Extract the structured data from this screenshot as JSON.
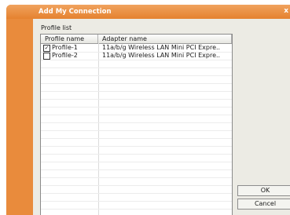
{
  "window": {
    "title": "Add My Connection",
    "close_glyph": "x"
  },
  "profile_list": {
    "label": "Profile list",
    "columns": [
      "Profile name",
      "Adapter name"
    ],
    "rows": [
      {
        "checked": true,
        "name": "Profile-1",
        "adapter": "11a/b/g Wireless LAN Mini PCI Expre.."
      },
      {
        "checked": false,
        "name": "Profile-2",
        "adapter": "11a/b/g Wireless LAN Mini PCI Expre.."
      }
    ],
    "empty_rows": 21
  },
  "buttons": {
    "ok": "OK",
    "cancel": "Cancel"
  },
  "colors": {
    "title_bar": "#e5822f",
    "dialog_body": "#ecebe4"
  }
}
